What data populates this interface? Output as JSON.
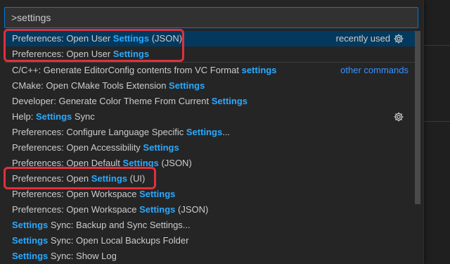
{
  "search": {
    "value": ">settings"
  },
  "items": [
    {
      "pre": "Preferences: Open User ",
      "hl": "Settings",
      "post": " (JSON)",
      "meta": "recently used",
      "gear": true,
      "selected": true
    },
    {
      "pre": "Preferences: Open User ",
      "hl": "Settings",
      "post": ""
    },
    {
      "pre": "C/C++: Generate EditorConfig contents from VC Format ",
      "hl": "settings",
      "post": "",
      "meta_link": "other commands"
    },
    {
      "pre": "CMake: Open CMake Tools Extension ",
      "hl": "Settings",
      "post": ""
    },
    {
      "pre": "Developer: Generate Color Theme From Current ",
      "hl": "Settings",
      "post": ""
    },
    {
      "pre": "Help: ",
      "hl": "Settings",
      "post": " Sync",
      "gear": true
    },
    {
      "pre": "Preferences: Configure Language Specific ",
      "hl": "Settings",
      "post": "..."
    },
    {
      "pre": "Preferences: Open Accessibility ",
      "hl": "Settings",
      "post": ""
    },
    {
      "pre": "Preferences: Open Default ",
      "hl": "Settings",
      "post": " (JSON)"
    },
    {
      "pre": "Preferences: Open ",
      "hl": "Settings",
      "post": " (UI)"
    },
    {
      "pre": "Preferences: Open Workspace ",
      "hl": "Settings",
      "post": ""
    },
    {
      "pre": "Preferences: Open Workspace ",
      "hl": "Settings",
      "post": " (JSON)"
    },
    {
      "pre": "",
      "hl": "Settings",
      "post": " Sync: Backup and Sync Settings..."
    },
    {
      "pre": "",
      "hl": "Settings",
      "post": " Sync: Open Local Backups Folder"
    },
    {
      "pre": "",
      "hl": "Settings",
      "post": " Sync: Show Log"
    }
  ],
  "colors": {
    "accent": "#2aaaff",
    "selection": "#04395e",
    "annotation": "#e0303a",
    "focus_border": "#0078d4"
  },
  "icons": {
    "gear": "gear-icon"
  }
}
